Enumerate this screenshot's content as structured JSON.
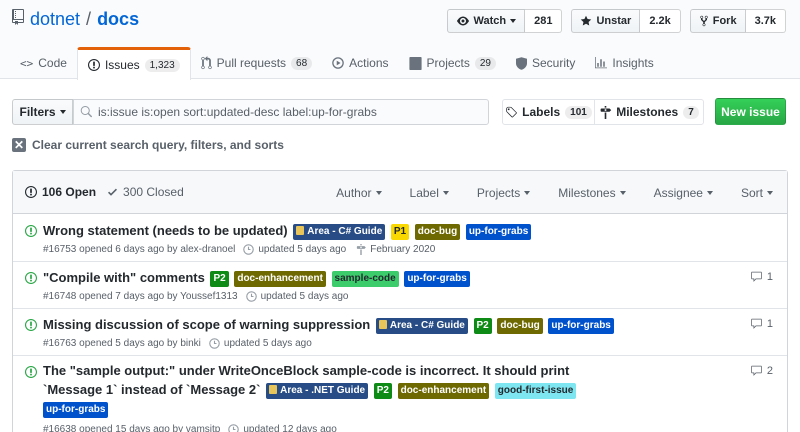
{
  "repo": {
    "owner": "dotnet",
    "name": "docs"
  },
  "actions": {
    "watch": {
      "label": "Watch",
      "count": "281"
    },
    "unstar": {
      "label": "Unstar",
      "count": "2.2k"
    },
    "fork": {
      "label": "Fork",
      "count": "3.7k"
    }
  },
  "nav": {
    "code": {
      "label": "Code"
    },
    "issues": {
      "label": "Issues",
      "count": "1,323"
    },
    "pulls": {
      "label": "Pull requests",
      "count": "68"
    },
    "actions": {
      "label": "Actions"
    },
    "projects": {
      "label": "Projects",
      "count": "29"
    },
    "security": {
      "label": "Security"
    },
    "insights": {
      "label": "Insights"
    }
  },
  "filterbar": {
    "filters_label": "Filters",
    "search_value": "is:issue is:open sort:updated-desc label:up-for-grabs",
    "labels": {
      "label": "Labels",
      "count": "101"
    },
    "milestones": {
      "label": "Milestones",
      "count": "7"
    },
    "new_issue": "New issue"
  },
  "clear_query": "Clear current search query, filters, and sorts",
  "table": {
    "open": "106 Open",
    "closed": "300 Closed",
    "filters": [
      "Author",
      "Label",
      "Projects",
      "Milestones",
      "Assignee",
      "Sort"
    ]
  },
  "issues": [
    {
      "title": "Wrong statement (needs to be updated)",
      "labels": [
        "Area - C# Guide",
        "P1",
        "doc-bug",
        "up-for-grabs"
      ],
      "meta": "#16753 opened 6 days ago by alex-dranoel",
      "updated": "updated 5 days ago",
      "milestone": "February 2020",
      "comments": ""
    },
    {
      "title": "\"Compile with\" comments",
      "labels": [
        "P2",
        "doc-enhancement",
        "sample-code",
        "up-for-grabs"
      ],
      "meta": "#16748 opened 7 days ago by Youssef1313",
      "updated": "updated 5 days ago",
      "milestone": "",
      "comments": "1"
    },
    {
      "title": "Missing discussion of scope of warning suppression",
      "labels": [
        "Area - C# Guide",
        "P2",
        "doc-bug",
        "up-for-grabs"
      ],
      "meta": "#16763 opened 5 days ago by binki",
      "updated": "updated 5 days ago",
      "milestone": "",
      "comments": "1"
    },
    {
      "title_line1": "The \"sample output:\" under WriteOnceBlock sample-code is incorrect. It should print",
      "title_line2": "`Message 1` instead of `Message 2`",
      "labels": [
        "Area - .NET Guide",
        "P2",
        "doc-enhancement",
        "good-first-issue",
        "up-for-grabs"
      ],
      "meta": "#16638 opened 15 days ago by vamsitp",
      "updated": "updated 12 days ago",
      "milestone": "",
      "comments": "2"
    }
  ],
  "colors": {
    "open_green": "#28a745",
    "link_blue": "#0366d6",
    "tab_accent": "#e36209"
  }
}
